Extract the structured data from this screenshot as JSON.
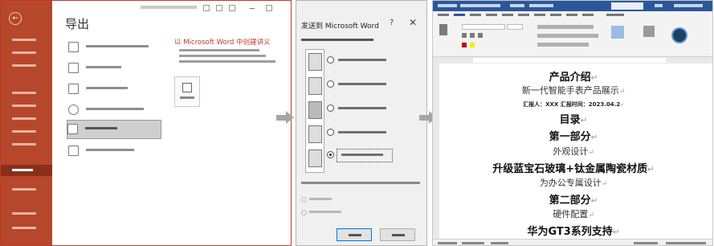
{
  "panel_export": {
    "title": "导出",
    "pdf_heading": "以 Microsoft Word 中创建讲义"
  },
  "panel_dialog": {
    "title": "发送到 Microsoft Word",
    "help": "?",
    "close": "✕"
  },
  "panel_word": {
    "lines": [
      {
        "text": "产品介绍",
        "style": "h"
      },
      {
        "text": "新一代智能手表产品展示",
        "style": "b"
      },
      {
        "text": "汇报人：XXX  汇报时间：2023.04.2",
        "style": "m"
      },
      {
        "text": "目录",
        "style": "h"
      },
      {
        "text": "第一部分",
        "style": "h"
      },
      {
        "text": "外观设计",
        "style": "b"
      },
      {
        "text": "升级蓝宝石玻璃+钛金属陶瓷材质",
        "style": "h"
      },
      {
        "text": "为办公专属设计",
        "style": "b"
      },
      {
        "text": "第二部分",
        "style": "h"
      },
      {
        "text": "硬件配置",
        "style": "b"
      },
      {
        "text": "华为GT3系列支持",
        "style": "h"
      }
    ],
    "paragraph_mark": "↵"
  }
}
